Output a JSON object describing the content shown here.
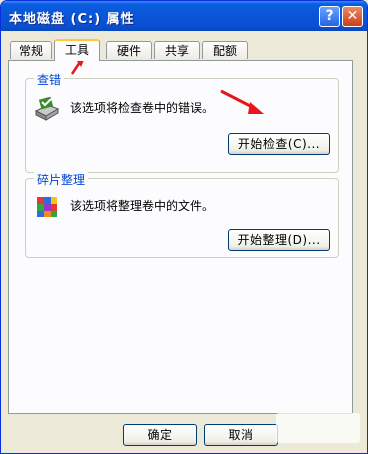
{
  "window": {
    "title": "本地磁盘 (C:) 属性"
  },
  "titlebar_buttons": {
    "help": "?",
    "close": "✕"
  },
  "tabs": [
    {
      "label": "常规"
    },
    {
      "label": "工具"
    },
    {
      "label": "硬件"
    },
    {
      "label": "共享"
    },
    {
      "label": "配额"
    }
  ],
  "active_tab": "工具",
  "error_check": {
    "title": "查错",
    "description": "该选项将检查卷中的错误。",
    "button": "开始检查(C)..."
  },
  "defrag": {
    "title": "碎片整理",
    "description": "该选项将整理卷中的文件。",
    "button": "开始整理(D)..."
  },
  "footer": {
    "ok": "确定",
    "cancel": "取消"
  },
  "colors": {
    "annotation_arrow": "#e8161b",
    "titlebar": "#0a54d8",
    "group_title": "#0046d5"
  },
  "icons": {
    "check_disk": "check-disk-icon",
    "defrag": "defrag-icon"
  }
}
